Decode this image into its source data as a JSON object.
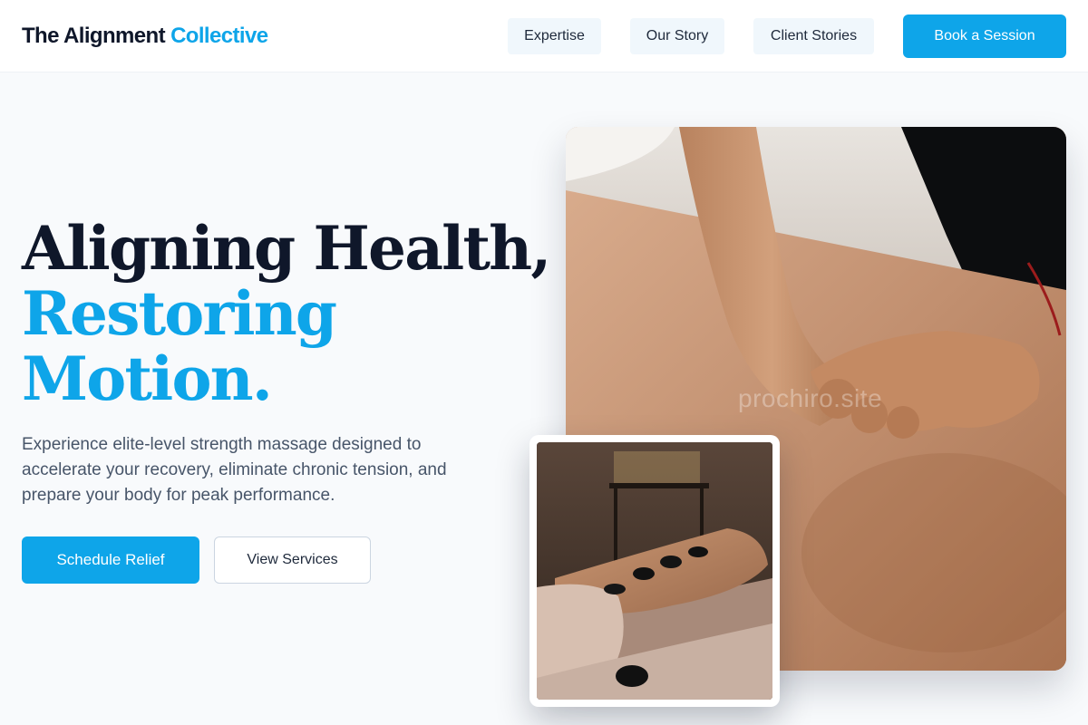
{
  "header": {
    "brand_main": "The Alignment",
    "brand_accent": "Collective",
    "nav": {
      "expertise": "Expertise",
      "our_story": "Our Story",
      "client_stories": "Client Stories"
    },
    "book_label": "Book a Session"
  },
  "hero": {
    "title_line1": "Aligning Health,",
    "title_line2": "Restoring",
    "title_line3": "Motion.",
    "subtitle": "Experience elite-level strength massage designed to accelerate your recovery, eliminate chronic tension, and prepare your body for peak performance.",
    "primary_cta": "Schedule Relief",
    "secondary_cta": "View Services"
  },
  "media": {
    "watermark": "prochiro.site"
  },
  "colors": {
    "accent": "#0ea5e9",
    "heading": "#0f172a",
    "body_text": "#475569",
    "background": "#f8fafc",
    "nav_bg": "#f0f7fc"
  }
}
